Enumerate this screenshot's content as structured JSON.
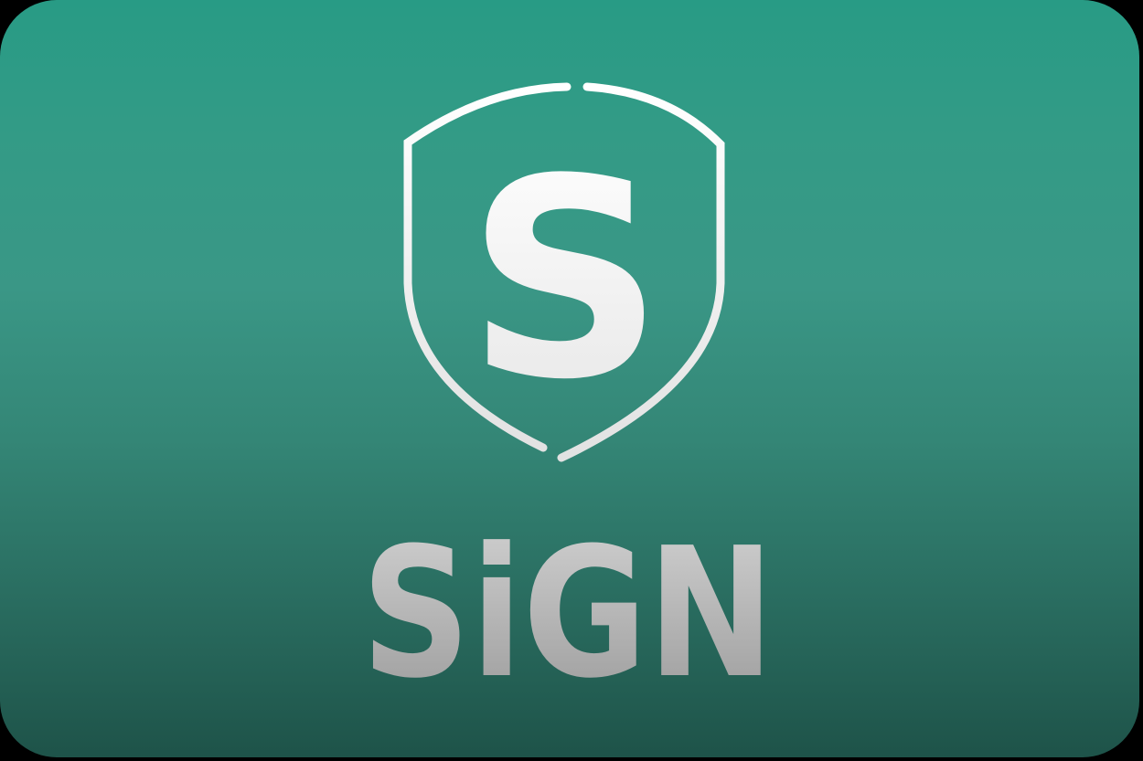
{
  "logo": {
    "emblem_letter": "S",
    "wordmark": "SiGN"
  },
  "icons": {
    "emblem": "shield-icon"
  },
  "colors": {
    "background_top": "#289b85",
    "background_bottom": "#1e5349",
    "emblem_stroke": "#ececec",
    "wordmark_top": "#d2d2d2",
    "wordmark_bottom": "#9a9a9a"
  }
}
